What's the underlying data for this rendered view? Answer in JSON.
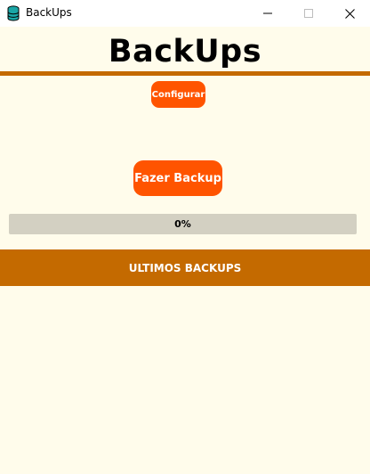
{
  "window": {
    "title": "BackUps",
    "icon": "database-icon",
    "controls": {
      "minimize": "minimize-icon",
      "maximize": "maximize-icon",
      "close": "close-icon"
    }
  },
  "header": {
    "title": "BackUps"
  },
  "toolbar": {
    "config_label": "Configurar",
    "backup_label": "Fazer Backup"
  },
  "progress": {
    "value": 0,
    "label": "0%"
  },
  "history": {
    "title": "ULTIMOS BACKUPS",
    "items": []
  },
  "colors": {
    "background": "#fffceb",
    "accent": "#c46a00",
    "button": "#ff5400",
    "progress_track": "#d3d0c2"
  }
}
